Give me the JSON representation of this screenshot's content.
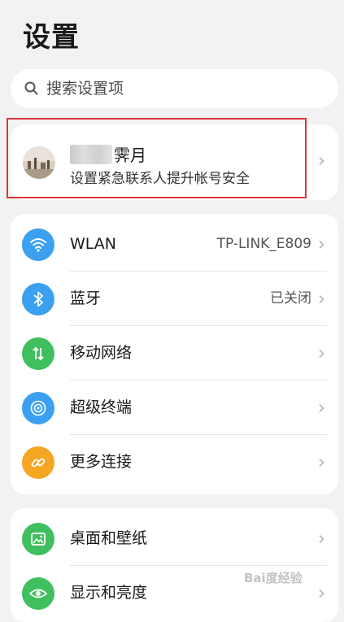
{
  "header": {
    "title": "设置"
  },
  "search": {
    "placeholder": "搜索设置项"
  },
  "account": {
    "name_visible_part": "霁月",
    "subtitle": "设置紧急联系人提升帐号安全"
  },
  "network_group": {
    "items": [
      {
        "label": "WLAN",
        "value": "TP-LINK_E809",
        "icon": "wifi-icon",
        "color": "#3ba0f0"
      },
      {
        "label": "蓝牙",
        "value": "已关闭",
        "icon": "bluetooth-icon",
        "color": "#3ba0f0"
      },
      {
        "label": "移动网络",
        "value": "",
        "icon": "mobile-data-icon",
        "color": "#3fbf5f"
      },
      {
        "label": "超级终端",
        "value": "",
        "icon": "super-device-icon",
        "color": "#3ba0f0"
      },
      {
        "label": "更多连接",
        "value": "",
        "icon": "link-icon",
        "color": "#f5a623"
      }
    ]
  },
  "display_group": {
    "items": [
      {
        "label": "桌面和壁纸",
        "icon": "wallpaper-icon",
        "color": "#3fbf5f"
      },
      {
        "label": "显示和亮度",
        "icon": "eye-icon",
        "color": "#3fbf5f"
      }
    ]
  },
  "watermark": {
    "text": "Bai度经验"
  }
}
